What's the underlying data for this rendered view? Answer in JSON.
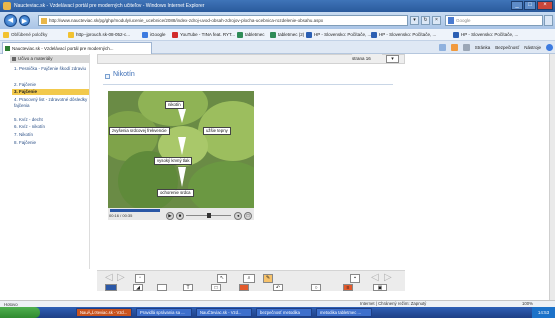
{
  "window": {
    "title": "NauÄŤteviac.sk - VzdelĂˇvacĂ­ portĂˇl pre modernĂ˝ch uÄŤiteÄľov - Windows Internet Explorer",
    "title_display": "Naucteviac.sk - Vzdelávací portál pre moderných učiteľov - Windows Internet Explorer"
  },
  "address": {
    "url": "http://www.naucteviac.sk/pg/ghp/moduly/ucenie_ucebnice/2088/index-zdroj-uvod-obsah-zdrojov-plocha-ucebnica-rozdelenie-obsahu.aspx",
    "search_placeholder": "Google"
  },
  "favorites": {
    "label": "Obľúbené položky",
    "items": [
      "http--jprouch.sk-08-052-c...",
      "iGoogle",
      "YouTube - TINA feat. RYT...",
      "tabletmec",
      "tabletmec (2)",
      "HP - Slovensko: Počítače, ...",
      "HP - Slovensko: Počítače, ...",
      "HP - Slovensko: Počítače, ..."
    ]
  },
  "tab": {
    "label": "Naucteviac.sk - Vzdelávací portál pre moderných...",
    "commands": [
      "Stránka",
      "Bezpečnosť",
      "Nástroje"
    ]
  },
  "sidebar": {
    "header": "Učivo a materiály",
    "items": [
      {
        "label": "1. Pesnička - Fajčenie škodí zdraviu",
        "active": false
      },
      {
        "label": "2. Fajčenie",
        "active": false
      },
      {
        "label": "3. Fajčenie",
        "active": true
      },
      {
        "label": "4. Pracovný list - zdravotné dôsledky fajčenia",
        "active": false
      },
      {
        "label": "5. Kvíz - decht",
        "active": false
      },
      {
        "label": "6. Kvíz - nikotín",
        "active": false
      },
      {
        "label": "7. Nikotín",
        "active": false
      },
      {
        "label": "8. Fajčenie",
        "active": false
      }
    ]
  },
  "content": {
    "page_label": "strana",
    "page_number": "16",
    "lesson_title": "Nikotín"
  },
  "video": {
    "diagram": {
      "top": "nikotín",
      "left": "zvyšenia srdcovej frekvencie",
      "right": "užšie tepny",
      "middle": "vysoký krvný tlak",
      "bottom": "ochorenie srdca"
    },
    "time": "00:16 / 00:35",
    "progress": 0.35,
    "volume": 0.5
  },
  "statusbar": {
    "left": "Hotovo",
    "zone": "Internet | Chránený režim: Zapnutý",
    "zoom": "100%"
  },
  "taskbar": {
    "items": [
      {
        "label": "NauĂ„Ĺ¤teviac.sk - Vzd...",
        "active": true
      },
      {
        "label": "Pravidlá správania sa ...",
        "active": false
      },
      {
        "label": "NauČteviac.sk - Vzd...",
        "active": false
      },
      {
        "label": "bezpečnosť metodika",
        "active": false
      },
      {
        "label": "metodika tabletmec ...",
        "active": false
      }
    ],
    "clock": "14:53"
  },
  "colors": {
    "active_nav": "#f2c94c",
    "link": "#2a4f86",
    "title": "#3d6fb6"
  }
}
